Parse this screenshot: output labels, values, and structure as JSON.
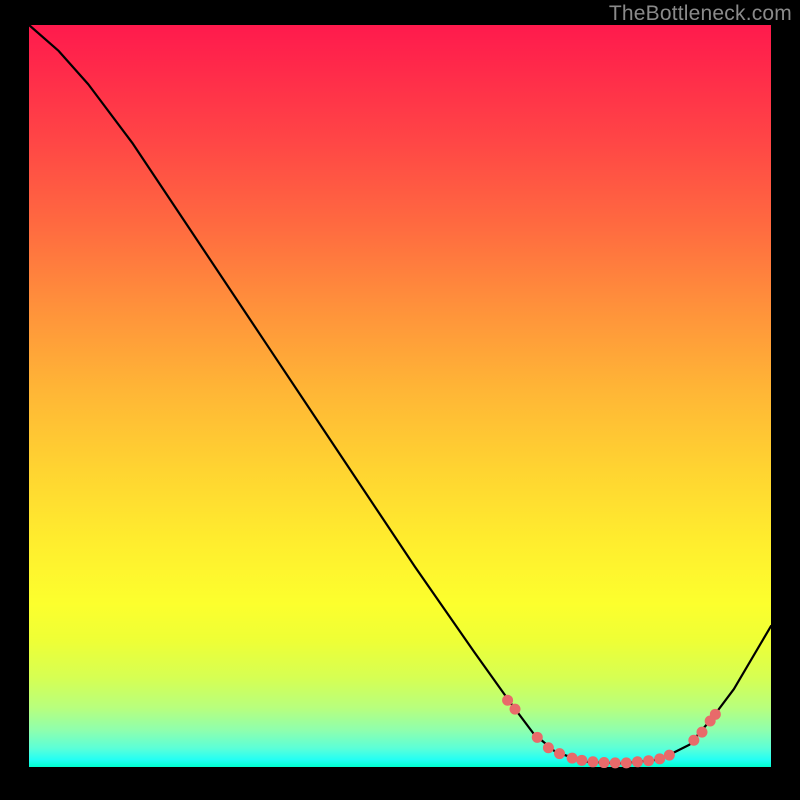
{
  "watermark": "TheBottleneck.com",
  "colors": {
    "curve_stroke": "#000000",
    "marker_fill": "#e86a6a",
    "marker_stroke": "#e86a6a"
  },
  "chart_data": {
    "type": "line",
    "title": "",
    "xlabel": "",
    "ylabel": "",
    "xlim": [
      0,
      100
    ],
    "ylim": [
      0,
      100
    ],
    "curve": [
      {
        "x": 0.0,
        "y": 100.0
      },
      {
        "x": 4.0,
        "y": 96.5
      },
      {
        "x": 8.0,
        "y": 92.0
      },
      {
        "x": 14.0,
        "y": 84.0
      },
      {
        "x": 22.0,
        "y": 72.0
      },
      {
        "x": 32.0,
        "y": 57.0
      },
      {
        "x": 42.0,
        "y": 42.0
      },
      {
        "x": 52.0,
        "y": 27.0
      },
      {
        "x": 60.0,
        "y": 15.5
      },
      {
        "x": 65.0,
        "y": 8.5
      },
      {
        "x": 68.0,
        "y": 4.5
      },
      {
        "x": 71.0,
        "y": 2.0
      },
      {
        "x": 75.0,
        "y": 0.7
      },
      {
        "x": 80.0,
        "y": 0.5
      },
      {
        "x": 85.0,
        "y": 1.0
      },
      {
        "x": 89.0,
        "y": 3.0
      },
      {
        "x": 92.0,
        "y": 6.5
      },
      {
        "x": 95.0,
        "y": 10.5
      },
      {
        "x": 100.0,
        "y": 19.0
      }
    ],
    "markers": [
      {
        "x": 64.5,
        "y": 9.0
      },
      {
        "x": 65.5,
        "y": 7.8
      },
      {
        "x": 68.5,
        "y": 4.0
      },
      {
        "x": 70.0,
        "y": 2.6
      },
      {
        "x": 71.5,
        "y": 1.8
      },
      {
        "x": 73.2,
        "y": 1.2
      },
      {
        "x": 74.5,
        "y": 0.9
      },
      {
        "x": 76.0,
        "y": 0.7
      },
      {
        "x": 77.5,
        "y": 0.6
      },
      {
        "x": 79.0,
        "y": 0.55
      },
      {
        "x": 80.5,
        "y": 0.55
      },
      {
        "x": 82.0,
        "y": 0.7
      },
      {
        "x": 83.5,
        "y": 0.85
      },
      {
        "x": 85.0,
        "y": 1.1
      },
      {
        "x": 86.3,
        "y": 1.6
      },
      {
        "x": 89.6,
        "y": 3.6
      },
      {
        "x": 90.7,
        "y": 4.7
      },
      {
        "x": 91.8,
        "y": 6.2
      },
      {
        "x": 92.5,
        "y": 7.1
      }
    ]
  }
}
